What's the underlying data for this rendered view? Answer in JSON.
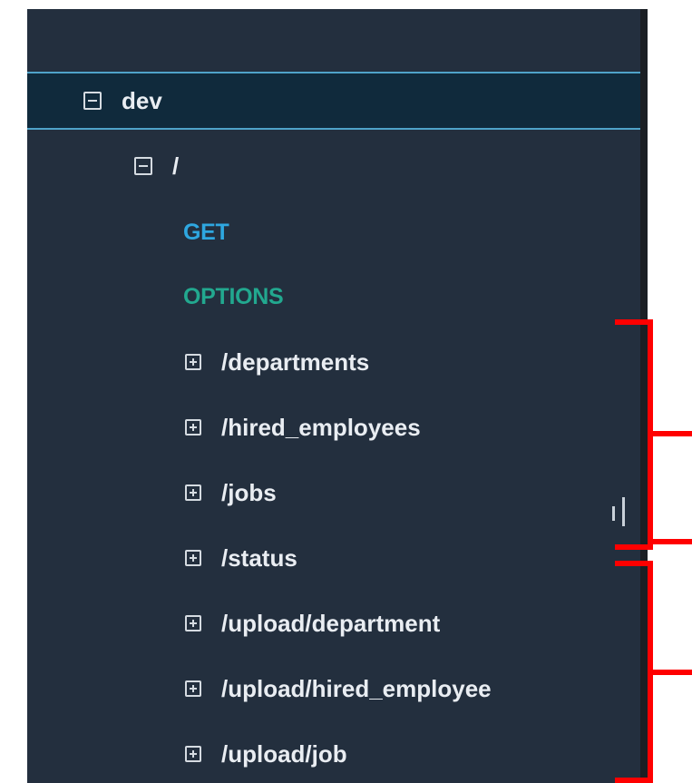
{
  "tree": {
    "stage": {
      "label": "dev",
      "expanded": true,
      "icon": "collapse-icon"
    },
    "root": {
      "label": "/",
      "expanded": true,
      "icon": "collapse-icon"
    },
    "methods": [
      {
        "label": "GET",
        "color": "#2ea7e0"
      },
      {
        "label": "OPTIONS",
        "color": "#22a88f"
      }
    ],
    "resources": [
      {
        "label": "/departments",
        "icon": "expand-icon"
      },
      {
        "label": "/hired_employees",
        "icon": "expand-icon"
      },
      {
        "label": "/jobs",
        "icon": "expand-icon"
      },
      {
        "label": "/status",
        "icon": "expand-icon"
      },
      {
        "label": "/upload/department",
        "icon": "expand-icon"
      },
      {
        "label": "/upload/hired_employee",
        "icon": "expand-icon"
      },
      {
        "label": "/upload/job",
        "icon": "expand-icon"
      }
    ]
  },
  "annotations": {
    "bracket_color": "#ff0000",
    "groups": [
      "bracket-1",
      "bracket-2"
    ]
  }
}
